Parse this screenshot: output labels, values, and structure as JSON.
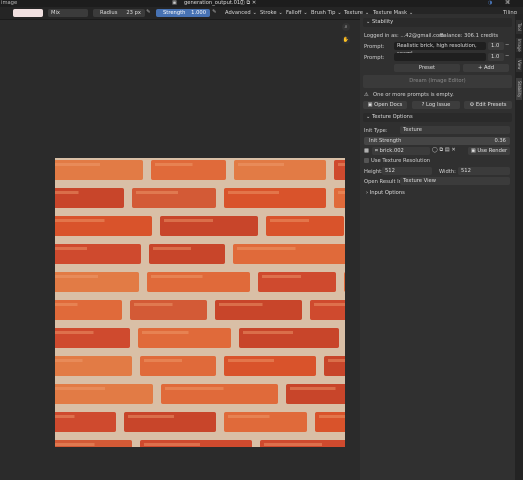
{
  "topbar": {
    "left_label": "image",
    "image_name": "generation_output.010"
  },
  "toolbar": {
    "blend_mode": "Mix",
    "radius_label": "Radius",
    "radius_value": "23 px",
    "strength_label": "Strength",
    "strength_value": "1.000",
    "menus": [
      "Advanced",
      "Stroke",
      "Falloff",
      "Brush Tip",
      "Texture",
      "Texture Mask"
    ],
    "tiling": "Tiling"
  },
  "side_tabs": [
    "Tool",
    "Image",
    "View",
    "Stability"
  ],
  "panel": {
    "title": "Stability",
    "logged_in": "Logged in as: ...42@gmail.com",
    "balance": "Balance: 306.1 credits",
    "prompt_label_1": "Prompt:",
    "prompt_value_1": "Realistic brick, high resolution, seaml...",
    "prompt_weight_1": "1.0",
    "prompt_label_2": "Prompt:",
    "prompt_value_2": "",
    "prompt_weight_2": "1.0",
    "preset_label": "Preset",
    "add_label": "Add",
    "dream_button": "Dream (Image Editor)",
    "warning": "One or more prompts is empty.",
    "open_docs": "Open Docs",
    "log_issue": "Log Issue",
    "edit_presets": "Edit Presets",
    "texture_options_title": "Texture Options",
    "init_type_label": "Init Type:",
    "init_type_value": "Texture",
    "init_strength_label": "Init Strength",
    "init_strength_value": "0.36",
    "texture_name": "brick.002",
    "use_render": "Use Render",
    "use_texture_resolution": "Use Texture Resolution",
    "height_label": "Height:",
    "height_value": "512",
    "width_label": "Width:",
    "width_value": "512",
    "open_result_label": "Open Result In:",
    "open_result_value": "Texture View",
    "input_options_title": "Input Options"
  }
}
